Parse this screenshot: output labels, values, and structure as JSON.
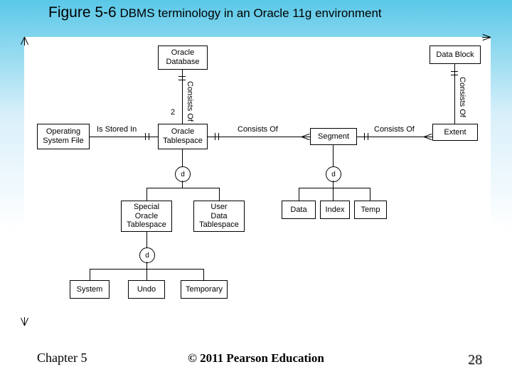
{
  "title": {
    "fig": "Figure 5-6",
    "rest": " DBMS terminology in an Oracle 11g environment"
  },
  "boxes": {
    "oracle_db": "Oracle\nDatabase",
    "data_block": "Data Block",
    "os_file": "Operating\nSystem File",
    "tablespace": "Oracle\nTablespace",
    "segment": "Segment",
    "extent": "Extent",
    "special_ts": "Special\nOracle\nTablespace",
    "user_ts": "User\nData\nTablespace",
    "data": "Data",
    "index": "Index",
    "temp": "Temp",
    "system": "System",
    "undo": "Undo",
    "temporary": "Temporary"
  },
  "rel": {
    "consists_of": "Consists Of",
    "is_stored_in": "Is Stored In",
    "two": "2"
  },
  "d": "d",
  "footer": {
    "left": "Chapter 5",
    "center": "© 2011 Pearson Education",
    "right": "28"
  }
}
